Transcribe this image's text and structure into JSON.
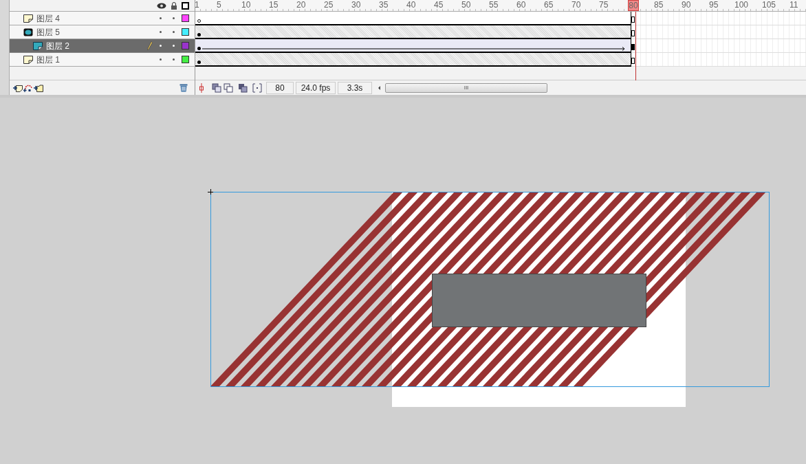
{
  "layers": [
    {
      "name": "图层 4",
      "kind": "normal",
      "selected": false,
      "color": "#ff44ff",
      "content": false,
      "tween": false
    },
    {
      "name": "图层 5",
      "kind": "mask",
      "selected": false,
      "color": "#44eeff",
      "content": true,
      "tween": false
    },
    {
      "name": "图层 2",
      "kind": "masked",
      "selected": true,
      "color": "#9933cc",
      "content": true,
      "tween": true
    },
    {
      "name": "图层 1",
      "kind": "normal",
      "selected": false,
      "color": "#44ee44",
      "content": true,
      "tween": false
    }
  ],
  "ruler": [
    {
      "label": "1",
      "selected": false
    },
    {
      "label": "5",
      "selected": false
    },
    {
      "label": "10",
      "selected": false
    },
    {
      "label": "15",
      "selected": false
    },
    {
      "label": "20",
      "selected": false
    },
    {
      "label": "25",
      "selected": false
    },
    {
      "label": "30",
      "selected": false
    },
    {
      "label": "35",
      "selected": false
    },
    {
      "label": "40",
      "selected": false
    },
    {
      "label": "45",
      "selected": false
    },
    {
      "label": "50",
      "selected": false
    },
    {
      "label": "55",
      "selected": false
    },
    {
      "label": "60",
      "selected": false
    },
    {
      "label": "65",
      "selected": false
    },
    {
      "label": "70",
      "selected": false
    },
    {
      "label": "75",
      "selected": false
    },
    {
      "label": "80",
      "selected": true
    },
    {
      "label": "85",
      "selected": false
    },
    {
      "label": "90",
      "selected": false
    },
    {
      "label": "95",
      "selected": false
    },
    {
      "label": "100",
      "selected": false
    },
    {
      "label": "105",
      "selected": false
    },
    {
      "label": "11",
      "selected": false
    }
  ],
  "status": {
    "current_frame": "80",
    "frame_rate": "24.0 fps",
    "elapsed": "3.3s"
  },
  "scrollbar_thumb": "III"
}
